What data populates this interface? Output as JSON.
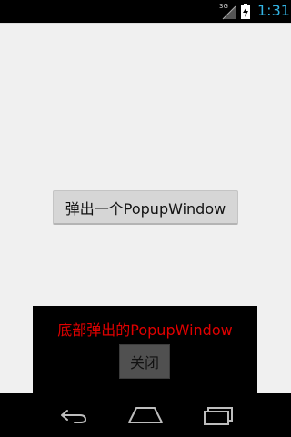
{
  "status_bar": {
    "network_type": "3G",
    "time": "1:31",
    "icons": [
      "signal-icon",
      "battery-charging-icon"
    ]
  },
  "main": {
    "show_popup_button_label": "弹出一个PopupWindow"
  },
  "popup": {
    "title": "底部弹出的PopupWindow",
    "close_label": "关闭",
    "title_color": "#e00000"
  },
  "nav_bar": {
    "icons": [
      "back-icon",
      "home-icon",
      "recent-apps-icon"
    ]
  },
  "colors": {
    "clock": "#33b5e5",
    "background": "#f0f0f0",
    "popup_background": "#000000"
  }
}
